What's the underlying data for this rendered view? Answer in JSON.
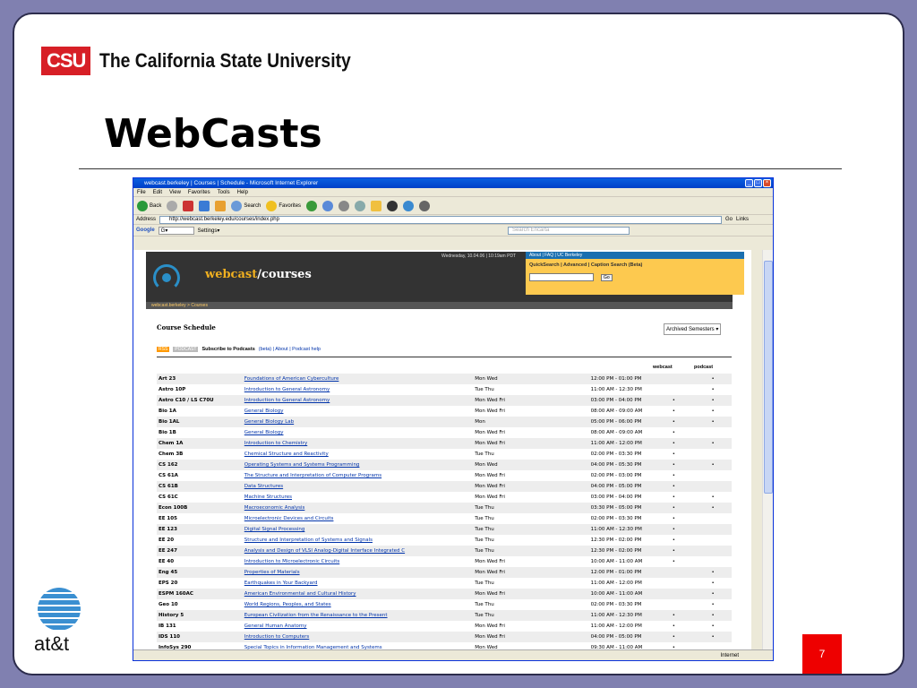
{
  "slide": {
    "csu_mark": "CSU",
    "csu_name": "The California State University",
    "title": "WebCasts",
    "att_text": "at&t",
    "page_number": "7"
  },
  "browser": {
    "window_title": "webcast.berkeley | Courses | Schedule - Microsoft Internet Explorer",
    "menu": [
      "File",
      "Edit",
      "View",
      "Favorites",
      "Tools",
      "Help"
    ],
    "toolbar": {
      "back": "Back",
      "search": "Search",
      "favorites": "Favorites"
    },
    "address_label": "Address",
    "address": "http://webcast.berkeley.edu/courses/index.php",
    "go": "Go",
    "links": "Links",
    "google": "Google",
    "google_g": "G▾",
    "settings": "Settings▾",
    "search_placeholder": "Search Encarta",
    "status": "Internet"
  },
  "site": {
    "date": "Wednesday, 10.04.06 | 10:19am PDT",
    "logo_a": "webcast",
    "logo_b": "/courses",
    "top_links": "About | FAQ | UC Berkeley",
    "quicksearch": "QuickSearch | Advanced | Caption Search (Beta)",
    "go": "Go",
    "breadcrumb": "webcast.berkeley > Courses",
    "schedule_title": "Course Schedule",
    "archived": "Archived Semesters",
    "rss": "RSS",
    "podcast_badge": "PODCAST",
    "subscribe": "Subscribe to Podcasts",
    "subscribe_note": "(beta) | About | Podcast help",
    "col_webcast": "webcast",
    "col_podcast": "podcast"
  },
  "courses": [
    {
      "code": "Art 23",
      "title": "Foundations of American Cyberculture",
      "days": "Mon Wed",
      "time": "12:00 PM - 01:00 PM",
      "webcast": "",
      "podcast": "•"
    },
    {
      "code": "Astro 10P",
      "title": "Introduction to General Astronomy",
      "days": "Tue Thu",
      "time": "11:00 AM - 12:30 PM",
      "webcast": "",
      "podcast": "•"
    },
    {
      "code": "Astro C10 / LS C70U",
      "title": "Introduction to General Astronomy",
      "days": "Mon Wed Fri",
      "time": "03:00 PM - 04:00 PM",
      "webcast": "•",
      "podcast": "•"
    },
    {
      "code": "Bio 1A",
      "title": "General Biology",
      "days": "Mon Wed Fri",
      "time": "08:00 AM - 09:00 AM",
      "webcast": "•",
      "podcast": "•"
    },
    {
      "code": "Bio 1AL",
      "title": "General Biology Lab",
      "days": "Mon",
      "time": "05:00 PM - 06:00 PM",
      "webcast": "•",
      "podcast": "•"
    },
    {
      "code": "Bio 1B",
      "title": "General Biology",
      "days": "Mon Wed Fri",
      "time": "08:00 AM - 09:00 AM",
      "webcast": "•",
      "podcast": ""
    },
    {
      "code": "Chem 1A",
      "title": "Introduction to Chemistry",
      "days": "Mon Wed Fri",
      "time": "11:00 AM - 12:00 PM",
      "webcast": "•",
      "podcast": "•"
    },
    {
      "code": "Chem 3B",
      "title": "Chemical Structure and Reactivity",
      "days": "Tue Thu",
      "time": "02:00 PM - 03:30 PM",
      "webcast": "•",
      "podcast": ""
    },
    {
      "code": "CS 162",
      "title": "Operating Systems and Systems Programming",
      "days": "Mon Wed",
      "time": "04:00 PM - 05:30 PM",
      "webcast": "•",
      "podcast": "•"
    },
    {
      "code": "CS 61A",
      "title": "The Structure and Interpretation of Computer Programs",
      "days": "Mon Wed Fri",
      "time": "02:00 PM - 03:00 PM",
      "webcast": "•",
      "podcast": ""
    },
    {
      "code": "CS 61B",
      "title": "Data Structures",
      "days": "Mon Wed Fri",
      "time": "04:00 PM - 05:00 PM",
      "webcast": "•",
      "podcast": ""
    },
    {
      "code": "CS 61C",
      "title": "Machine Structures",
      "days": "Mon Wed Fri",
      "time": "03:00 PM - 04:00 PM",
      "webcast": "•",
      "podcast": "•"
    },
    {
      "code": "Econ 100B",
      "title": "Macroeconomic Analysis",
      "days": "Tue Thu",
      "time": "03:30 PM - 05:00 PM",
      "webcast": "•",
      "podcast": "•"
    },
    {
      "code": "EE 105",
      "title": "Microelectronic Devices and Circuits",
      "days": "Tue Thu",
      "time": "02:00 PM - 03:30 PM",
      "webcast": "•",
      "podcast": ""
    },
    {
      "code": "EE 123",
      "title": "Digital Signal Processing",
      "days": "Tue Thu",
      "time": "11:00 AM - 12:30 PM",
      "webcast": "•",
      "podcast": ""
    },
    {
      "code": "EE 20",
      "title": "Structure and Interpretation of Systems and Signals",
      "days": "Tue Thu",
      "time": "12:30 PM - 02:00 PM",
      "webcast": "•",
      "podcast": ""
    },
    {
      "code": "EE 247",
      "title": "Analysis and Design of VLSI Analog-Digital Interface Integrated C",
      "days": "Tue Thu",
      "time": "12:30 PM - 02:00 PM",
      "webcast": "•",
      "podcast": ""
    },
    {
      "code": "EE 40",
      "title": "Introduction to Microelectronic Circuits",
      "days": "Mon Wed Fri",
      "time": "10:00 AM - 11:00 AM",
      "webcast": "•",
      "podcast": ""
    },
    {
      "code": "Eng 45",
      "title": "Properties of Materials",
      "days": "Mon Wed Fri",
      "time": "12:00 PM - 01:00 PM",
      "webcast": "",
      "podcast": "•"
    },
    {
      "code": "EPS 20",
      "title": "Earthquakes in Your Backyard",
      "days": "Tue Thu",
      "time": "11:00 AM - 12:00 PM",
      "webcast": "",
      "podcast": "•"
    },
    {
      "code": "ESPM 160AC",
      "title": "American Environmental and Cultural History",
      "days": "Mon Wed Fri",
      "time": "10:00 AM - 11:00 AM",
      "webcast": "",
      "podcast": "•"
    },
    {
      "code": "Geo 10",
      "title": "World Regions, Peoples, and States",
      "days": "Tue Thu",
      "time": "02:00 PM - 03:30 PM",
      "webcast": "",
      "podcast": "•"
    },
    {
      "code": "History 5",
      "title": "European Civilization from the Renaissance to the Present",
      "days": "Tue Thu",
      "time": "11:00 AM - 12:30 PM",
      "webcast": "•",
      "podcast": "•"
    },
    {
      "code": "IB 131",
      "title": "General Human Anatomy",
      "days": "Mon Wed Fri",
      "time": "11:00 AM - 12:00 PM",
      "webcast": "•",
      "podcast": "•"
    },
    {
      "code": "IDS 110",
      "title": "Introduction to Computers",
      "days": "Mon Wed Fri",
      "time": "04:00 PM - 05:00 PM",
      "webcast": "•",
      "podcast": "•"
    },
    {
      "code": "InfoSys 290",
      "title": "Special Topics in Information Management and Systems",
      "days": "Mon Wed",
      "time": "09:30 AM - 11:00 AM",
      "webcast": "•",
      "podcast": ""
    }
  ],
  "colors": {
    "csu_red": "#d71f26",
    "ie_blue": "#0a5fe0",
    "quicksearch_gold": "#fdc94f",
    "link_blue": "#0033aa"
  }
}
